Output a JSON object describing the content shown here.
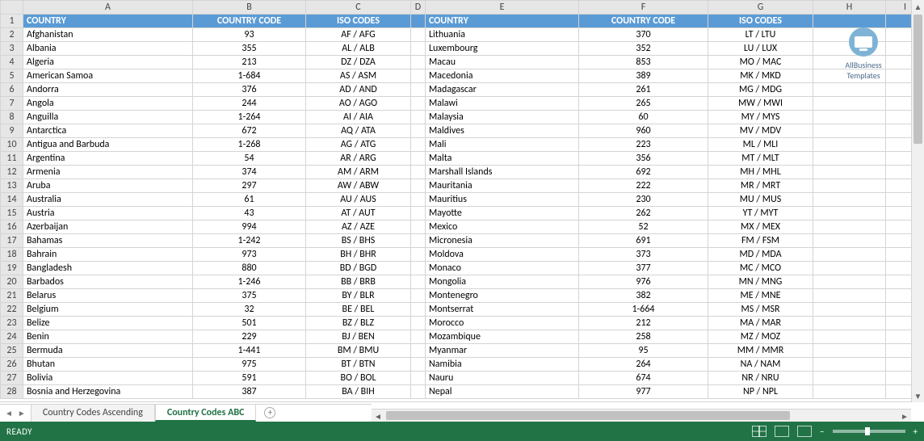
{
  "columns": [
    "A",
    "B",
    "C",
    "D",
    "E",
    "F",
    "G",
    "H",
    "I"
  ],
  "header_row": {
    "A": "COUNTRY",
    "B": "COUNTRY CODE",
    "C": "ISO CODES",
    "E": "COUNTRY",
    "F": "COUNTRY CODE",
    "G": "ISO CODES"
  },
  "rows": [
    {
      "n": 2,
      "A": "Afghanistan",
      "B": "93",
      "C": "AF / AFG",
      "E": "Lithuania",
      "F": "370",
      "G": "LT / LTU"
    },
    {
      "n": 3,
      "A": "Albania",
      "B": "355",
      "C": "AL / ALB",
      "E": "Luxembourg",
      "F": "352",
      "G": "LU / LUX"
    },
    {
      "n": 4,
      "A": "Algeria",
      "B": "213",
      "C": "DZ / DZA",
      "E": "Macau",
      "F": "853",
      "G": "MO / MAC"
    },
    {
      "n": 5,
      "A": "American Samoa",
      "B": "1-684",
      "C": "AS / ASM",
      "E": "Macedonia",
      "F": "389",
      "G": "MK / MKD"
    },
    {
      "n": 6,
      "A": "Andorra",
      "B": "376",
      "C": "AD / AND",
      "E": "Madagascar",
      "F": "261",
      "G": "MG / MDG"
    },
    {
      "n": 7,
      "A": "Angola",
      "B": "244",
      "C": "AO / AGO",
      "E": "Malawi",
      "F": "265",
      "G": "MW / MWI"
    },
    {
      "n": 8,
      "A": "Anguilla",
      "B": "1-264",
      "C": "AI / AIA",
      "E": "Malaysia",
      "F": "60",
      "G": "MY / MYS"
    },
    {
      "n": 9,
      "A": "Antarctica",
      "B": "672",
      "C": "AQ / ATA",
      "E": "Maldives",
      "F": "960",
      "G": "MV / MDV"
    },
    {
      "n": 10,
      "A": "Antigua and Barbuda",
      "B": "1-268",
      "C": "AG / ATG",
      "E": "Mali",
      "F": "223",
      "G": "ML / MLI"
    },
    {
      "n": 11,
      "A": "Argentina",
      "B": "54",
      "C": "AR / ARG",
      "E": "Malta",
      "F": "356",
      "G": "MT / MLT"
    },
    {
      "n": 12,
      "A": "Armenia",
      "B": "374",
      "C": "AM / ARM",
      "E": "Marshall Islands",
      "F": "692",
      "G": "MH / MHL"
    },
    {
      "n": 13,
      "A": "Aruba",
      "B": "297",
      "C": "AW / ABW",
      "E": "Mauritania",
      "F": "222",
      "G": "MR / MRT"
    },
    {
      "n": 14,
      "A": "Australia",
      "B": "61",
      "C": "AU / AUS",
      "E": "Mauritius",
      "F": "230",
      "G": "MU / MUS"
    },
    {
      "n": 15,
      "A": "Austria",
      "B": "43",
      "C": "AT / AUT",
      "E": "Mayotte",
      "F": "262",
      "G": "YT / MYT"
    },
    {
      "n": 16,
      "A": "Azerbaijan",
      "B": "994",
      "C": "AZ / AZE",
      "E": "Mexico",
      "F": "52",
      "G": "MX / MEX"
    },
    {
      "n": 17,
      "A": "Bahamas",
      "B": "1-242",
      "C": "BS / BHS",
      "E": "Micronesia",
      "F": "691",
      "G": "FM / FSM"
    },
    {
      "n": 18,
      "A": "Bahrain",
      "B": "973",
      "C": "BH / BHR",
      "E": "Moldova",
      "F": "373",
      "G": "MD / MDA"
    },
    {
      "n": 19,
      "A": "Bangladesh",
      "B": "880",
      "C": "BD / BGD",
      "E": "Monaco",
      "F": "377",
      "G": "MC / MCO"
    },
    {
      "n": 20,
      "A": "Barbados",
      "B": "1-246",
      "C": "BB / BRB",
      "E": "Mongolia",
      "F": "976",
      "G": "MN / MNG"
    },
    {
      "n": 21,
      "A": "Belarus",
      "B": "375",
      "C": "BY / BLR",
      "E": "Montenegro",
      "F": "382",
      "G": "ME / MNE"
    },
    {
      "n": 22,
      "A": "Belgium",
      "B": "32",
      "C": "BE / BEL",
      "E": "Montserrat",
      "F": "1-664",
      "G": "MS / MSR"
    },
    {
      "n": 23,
      "A": "Belize",
      "B": "501",
      "C": "BZ / BLZ",
      "E": "Morocco",
      "F": "212",
      "G": "MA / MAR"
    },
    {
      "n": 24,
      "A": "Benin",
      "B": "229",
      "C": "BJ / BEN",
      "E": "Mozambique",
      "F": "258",
      "G": "MZ / MOZ"
    },
    {
      "n": 25,
      "A": "Bermuda",
      "B": "1-441",
      "C": "BM / BMU",
      "E": "Myanmar",
      "F": "95",
      "G": "MM / MMR"
    },
    {
      "n": 26,
      "A": "Bhutan",
      "B": "975",
      "C": "BT / BTN",
      "E": "Namibia",
      "F": "264",
      "G": "NA / NAM"
    },
    {
      "n": 27,
      "A": "Bolivia",
      "B": "591",
      "C": "BO / BOL",
      "E": "Nauru",
      "F": "674",
      "G": "NR / NRU"
    },
    {
      "n": 28,
      "A": "Bosnia and Herzegovina",
      "B": "387",
      "C": "BA / BIH",
      "E": "Nepal",
      "F": "977",
      "G": "NP / NPL"
    }
  ],
  "sheet_tabs": [
    {
      "label": "Country Codes Ascending",
      "active": false
    },
    {
      "label": "Country Codes ABC",
      "active": true
    }
  ],
  "status": {
    "ready": "READY"
  },
  "logo": {
    "line1": "AllBusiness",
    "line2": "Templates"
  },
  "chart_data": {
    "type": "table",
    "title": "Country Codes ABC",
    "columns": [
      "COUNTRY",
      "COUNTRY CODE",
      "ISO CODES"
    ],
    "left_block": [
      [
        "Afghanistan",
        "93",
        "AF / AFG"
      ],
      [
        "Albania",
        "355",
        "AL / ALB"
      ],
      [
        "Algeria",
        "213",
        "DZ / DZA"
      ],
      [
        "American Samoa",
        "1-684",
        "AS / ASM"
      ],
      [
        "Andorra",
        "376",
        "AD / AND"
      ],
      [
        "Angola",
        "244",
        "AO / AGO"
      ],
      [
        "Anguilla",
        "1-264",
        "AI / AIA"
      ],
      [
        "Antarctica",
        "672",
        "AQ / ATA"
      ],
      [
        "Antigua and Barbuda",
        "1-268",
        "AG / ATG"
      ],
      [
        "Argentina",
        "54",
        "AR / ARG"
      ],
      [
        "Armenia",
        "374",
        "AM / ARM"
      ],
      [
        "Aruba",
        "297",
        "AW / ABW"
      ],
      [
        "Australia",
        "61",
        "AU / AUS"
      ],
      [
        "Austria",
        "43",
        "AT / AUT"
      ],
      [
        "Azerbaijan",
        "994",
        "AZ / AZE"
      ],
      [
        "Bahamas",
        "1-242",
        "BS / BHS"
      ],
      [
        "Bahrain",
        "973",
        "BH / BHR"
      ],
      [
        "Bangladesh",
        "880",
        "BD / BGD"
      ],
      [
        "Barbados",
        "1-246",
        "BB / BRB"
      ],
      [
        "Belarus",
        "375",
        "BY / BLR"
      ],
      [
        "Belgium",
        "32",
        "BE / BEL"
      ],
      [
        "Belize",
        "501",
        "BZ / BLZ"
      ],
      [
        "Benin",
        "229",
        "BJ / BEN"
      ],
      [
        "Bermuda",
        "1-441",
        "BM / BMU"
      ],
      [
        "Bhutan",
        "975",
        "BT / BTN"
      ],
      [
        "Bolivia",
        "591",
        "BO / BOL"
      ],
      [
        "Bosnia and Herzegovina",
        "387",
        "BA / BIH"
      ]
    ],
    "right_block": [
      [
        "Lithuania",
        "370",
        "LT / LTU"
      ],
      [
        "Luxembourg",
        "352",
        "LU / LUX"
      ],
      [
        "Macau",
        "853",
        "MO / MAC"
      ],
      [
        "Macedonia",
        "389",
        "MK / MKD"
      ],
      [
        "Madagascar",
        "261",
        "MG / MDG"
      ],
      [
        "Malawi",
        "265",
        "MW / MWI"
      ],
      [
        "Malaysia",
        "60",
        "MY / MYS"
      ],
      [
        "Maldives",
        "960",
        "MV / MDV"
      ],
      [
        "Mali",
        "223",
        "ML / MLI"
      ],
      [
        "Malta",
        "356",
        "MT / MLT"
      ],
      [
        "Marshall Islands",
        "692",
        "MH / MHL"
      ],
      [
        "Mauritania",
        "222",
        "MR / MRT"
      ],
      [
        "Mauritius",
        "230",
        "MU / MUS"
      ],
      [
        "Mayotte",
        "262",
        "YT / MYT"
      ],
      [
        "Mexico",
        "52",
        "MX / MEX"
      ],
      [
        "Micronesia",
        "691",
        "FM / FSM"
      ],
      [
        "Moldova",
        "373",
        "MD / MDA"
      ],
      [
        "Monaco",
        "377",
        "MC / MCO"
      ],
      [
        "Mongolia",
        "976",
        "MN / MNG"
      ],
      [
        "Montenegro",
        "382",
        "ME / MNE"
      ],
      [
        "Montserrat",
        "1-664",
        "MS / MSR"
      ],
      [
        "Morocco",
        "212",
        "MA / MAR"
      ],
      [
        "Mozambique",
        "258",
        "MZ / MOZ"
      ],
      [
        "Myanmar",
        "95",
        "MM / MMR"
      ],
      [
        "Namibia",
        "264",
        "NA / NAM"
      ],
      [
        "Nauru",
        "674",
        "NR / NRU"
      ],
      [
        "Nepal",
        "977",
        "NP / NPL"
      ]
    ]
  }
}
